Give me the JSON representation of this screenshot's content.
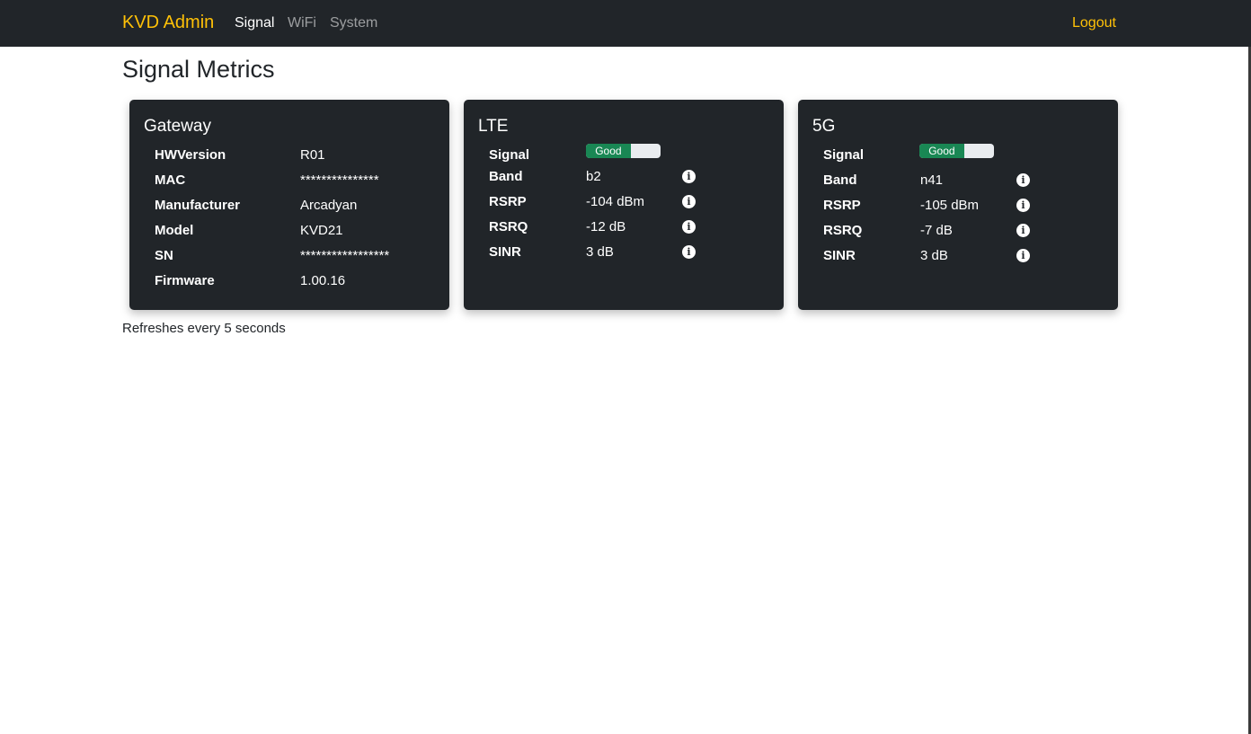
{
  "navbar": {
    "brand": "KVD Admin",
    "links": [
      {
        "label": "Signal",
        "active": true
      },
      {
        "label": "WiFi",
        "active": false
      },
      {
        "label": "System",
        "active": false
      }
    ],
    "logout": "Logout"
  },
  "page_title": "Signal Metrics",
  "gateway": {
    "title": "Gateway",
    "rows": [
      {
        "label": "HWVersion",
        "value": "R01"
      },
      {
        "label": "MAC",
        "value": "***************"
      },
      {
        "label": "Manufacturer",
        "value": "Arcadyan"
      },
      {
        "label": "Model",
        "value": "KVD21"
      },
      {
        "label": "SN",
        "value": "*****************"
      },
      {
        "label": "Firmware",
        "value": "1.00.16"
      }
    ]
  },
  "lte": {
    "title": "LTE",
    "signal_label": "Signal",
    "signal_quality": "Good",
    "signal_level_percent": 60,
    "rows": [
      {
        "label": "Band",
        "value": "b2"
      },
      {
        "label": "RSRP",
        "value": "-104 dBm"
      },
      {
        "label": "RSRQ",
        "value": "-12 dB"
      },
      {
        "label": "SINR",
        "value": "3 dB"
      }
    ]
  },
  "nr5g": {
    "title": "5G",
    "signal_label": "Signal",
    "signal_quality": "Good",
    "signal_level_percent": 60,
    "rows": [
      {
        "label": "Band",
        "value": "n41"
      },
      {
        "label": "RSRP",
        "value": "-105 dBm"
      },
      {
        "label": "RSRQ",
        "value": "-7 dB"
      },
      {
        "label": "SINR",
        "value": "3 dB"
      }
    ]
  },
  "footer_note": "Refreshes every 5 seconds",
  "icons": {
    "info": "info-circle-icon"
  },
  "colors": {
    "navbar": "#212529",
    "brand": "#ffc107",
    "good": "#198754",
    "card": "#212529"
  }
}
